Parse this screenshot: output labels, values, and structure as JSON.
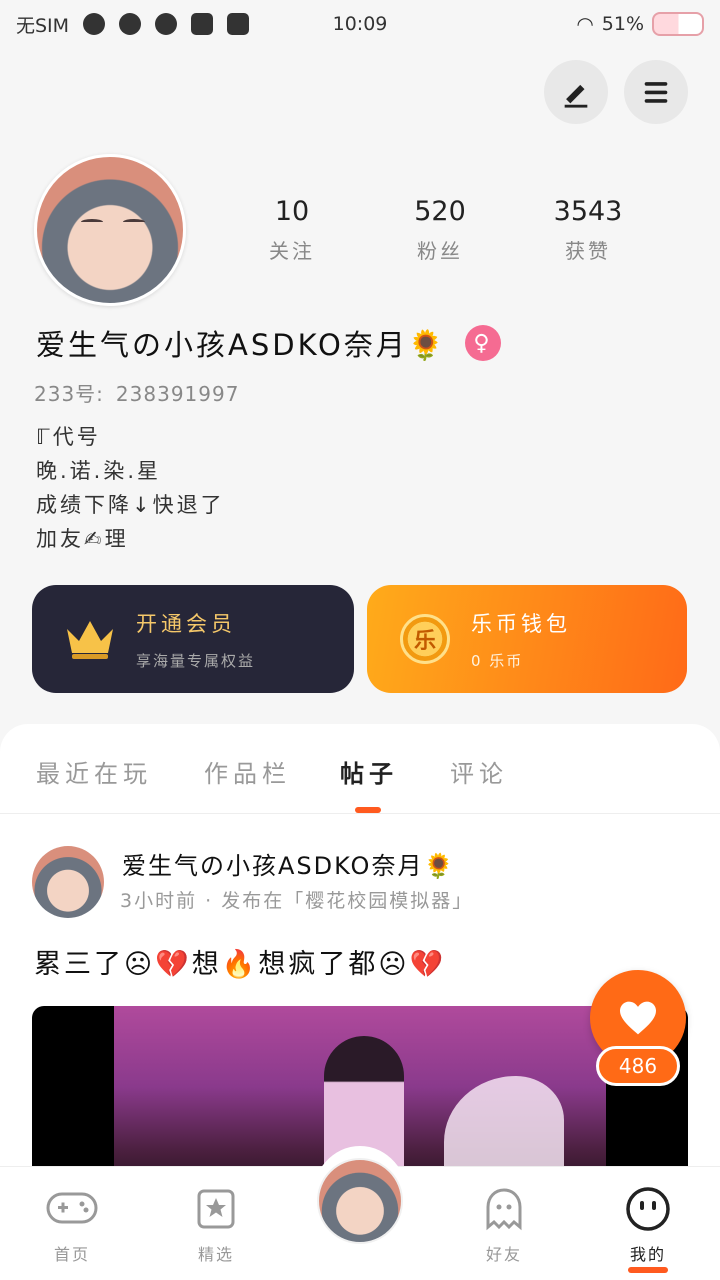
{
  "status_bar": {
    "carrier": "无SIM",
    "time": "10:09",
    "battery": "51%",
    "icons": [
      "cat-app-icon",
      "planet-app-icon",
      "wechat-icon",
      "s-app-icon",
      "video-icon",
      "wifi-icon",
      "battery-icon"
    ]
  },
  "header": {
    "edit_icon": "edit-icon",
    "menu_icon": "menu-icon"
  },
  "profile": {
    "stats": [
      {
        "value": "10",
        "label": "关注"
      },
      {
        "value": "520",
        "label": "粉丝"
      },
      {
        "value": "3543",
        "label": "获赞"
      }
    ],
    "nickname": "爱生气の小孩ASDKO奈月🌻",
    "gender_symbol": "♀",
    "uid_label": "233号:",
    "uid": "238391997",
    "bio": [
      "ℾ代号",
      "晚.诺.染.星",
      "成绩下降↓快退了",
      "加友✍理"
    ]
  },
  "cards": {
    "vip": {
      "title": "开通会员",
      "subtitle": "享海量专属权益"
    },
    "wallet": {
      "title": "乐币钱包",
      "subtitle": "0 乐币",
      "coin_text": "乐"
    }
  },
  "tabs": [
    {
      "label": "最近在玩",
      "active": false
    },
    {
      "label": "作品栏",
      "active": false
    },
    {
      "label": "帖子",
      "active": true
    },
    {
      "label": "评论",
      "active": false
    }
  ],
  "post": {
    "author": "爱生气の小孩ASDKO奈月🌻",
    "meta": "3小时前 · 发布在「樱花校园模拟器」",
    "text": "累三了☹💔想🔥想疯了都☹💔",
    "likes": "486"
  },
  "bottom_nav": [
    {
      "label": "首页",
      "icon": "gamepad-icon",
      "active": false
    },
    {
      "label": "精选",
      "icon": "star-bookmark-icon",
      "active": false
    },
    {
      "label": "好友",
      "icon": "ghost-icon",
      "active": false
    },
    {
      "label": "我的",
      "icon": "smiley-face-icon",
      "active": true
    }
  ],
  "colors": {
    "accent": "#ff6a16",
    "vip_bg": "#262638",
    "vip_title": "#f5c86a",
    "gender_pink": "#f56b92"
  }
}
